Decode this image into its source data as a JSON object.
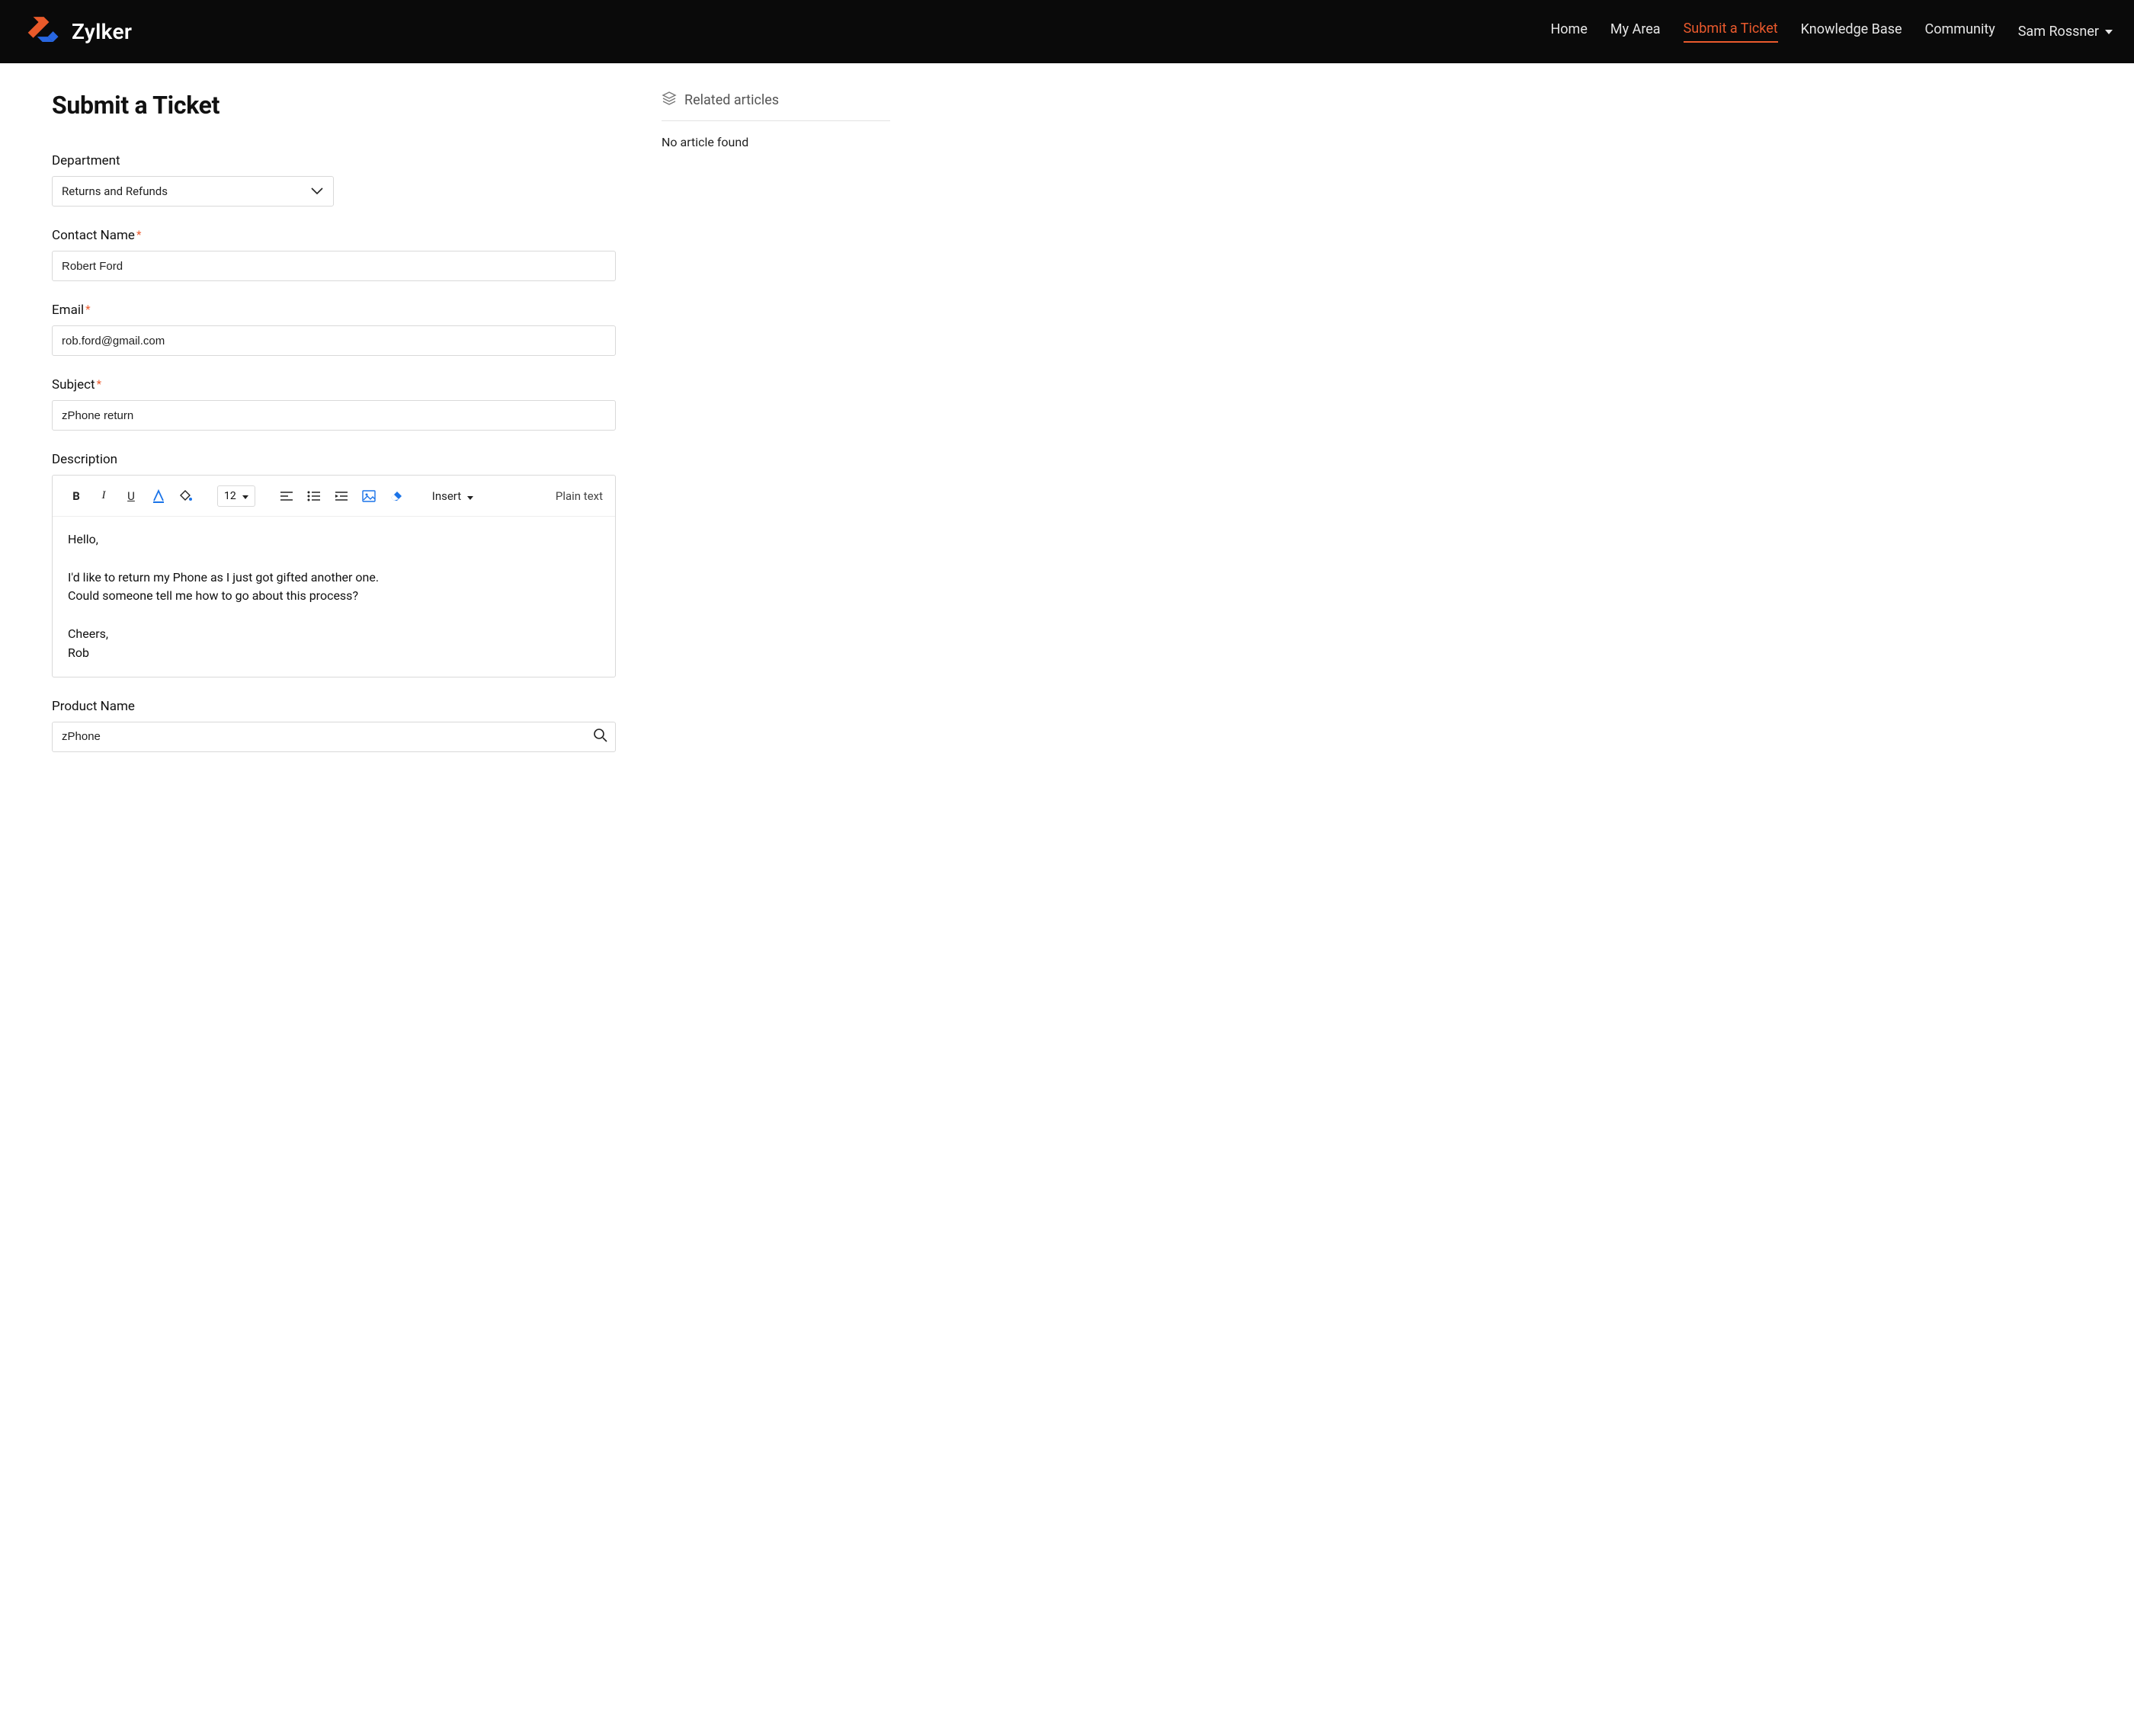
{
  "brand": {
    "name": "Zylker"
  },
  "nav": {
    "home": "Home",
    "my_area": "My Area",
    "submit_ticket": "Submit a Ticket",
    "knowledge_base": "Knowledge Base",
    "community": "Community",
    "user": "Sam Rossner"
  },
  "page_title": "Submit a Ticket",
  "form": {
    "department": {
      "label": "Department",
      "value": "Returns and Refunds"
    },
    "contact_name": {
      "label": "Contact Name",
      "value": "Robert Ford"
    },
    "email": {
      "label": "Email",
      "value": "rob.ford@gmail.com"
    },
    "subject": {
      "label": "Subject",
      "value": "zPhone return"
    },
    "description": {
      "label": "Description",
      "body": "Hello,\n\nI'd like to return my Phone as I just got gifted another one.\nCould someone tell me how to go about this process?\n\nCheers,\nRob"
    },
    "product_name": {
      "label": "Product Name",
      "value": "zPhone"
    }
  },
  "editor_toolbar": {
    "font_size": "12",
    "insert_label": "Insert",
    "plain_text": "Plain text"
  },
  "sidebar": {
    "header": "Related articles",
    "empty": "No article found"
  }
}
